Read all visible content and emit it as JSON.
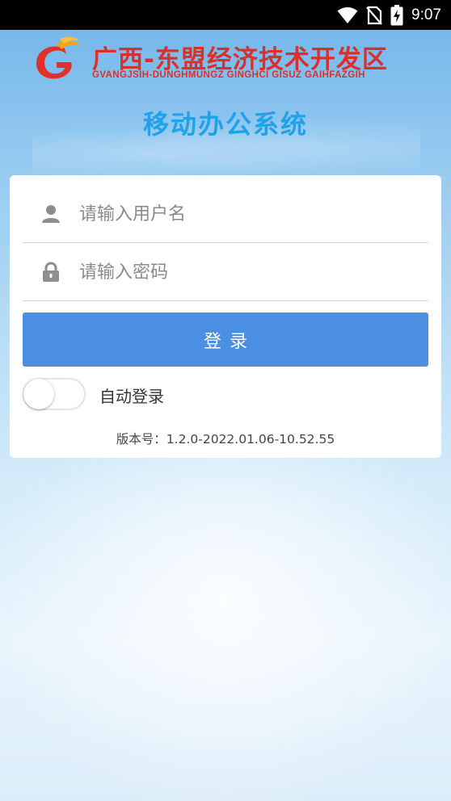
{
  "status_bar": {
    "time": "9:07",
    "icons": [
      "wifi-icon",
      "no-sim-icon",
      "battery-charging-icon"
    ]
  },
  "header": {
    "org_name_cn": "广西-东盟经济技术开发区",
    "org_name_en": "GVANGJSIH-DUNGHMUNGZ GINGHCI GISUZ GAIHFAZGIH",
    "app_title": "移动办公系统"
  },
  "login": {
    "username": {
      "placeholder": "请输入用户名",
      "value": "",
      "icon": "user-icon"
    },
    "password": {
      "placeholder": "请输入密码",
      "value": "",
      "icon": "lock-icon"
    },
    "submit_label": "登录",
    "auto_login": {
      "label": "自动登录",
      "enabled": false
    },
    "version_text": "版本号：1.2.0-2022.01.06-10.52.55"
  },
  "colors": {
    "brand_red": "#d8312b",
    "title_blue": "#1fa3e6",
    "button_blue": "#4a8fe2"
  }
}
